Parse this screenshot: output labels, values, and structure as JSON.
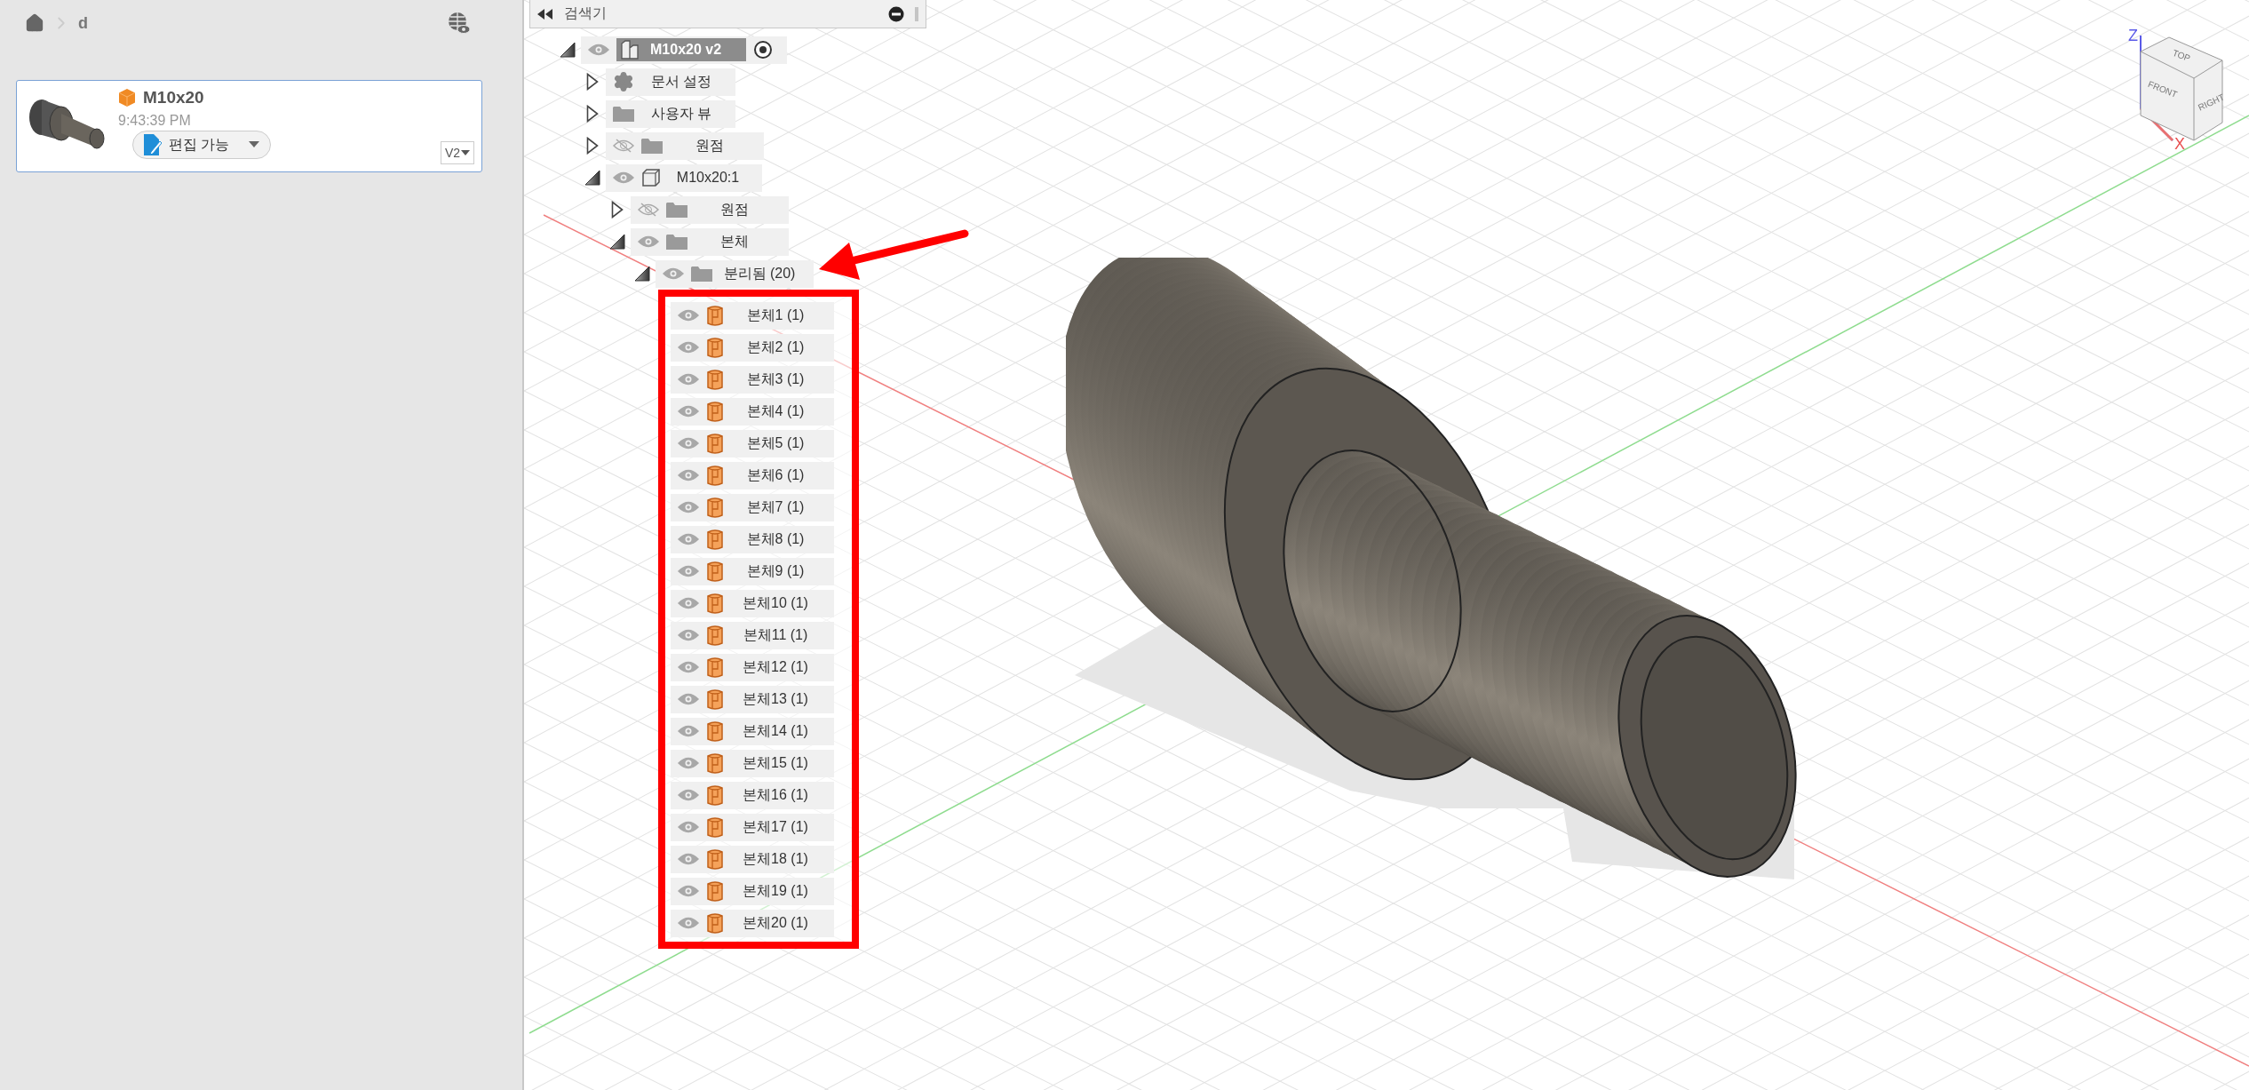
{
  "breadcrumb": [
    "d"
  ],
  "file_card": {
    "name": "M10x20",
    "time": "9:43:39 PM",
    "permission": "편집 가능",
    "version": "V2"
  },
  "browser": {
    "title": "검색기",
    "tree": [
      {
        "label": "M10x20 v2",
        "kind": "root",
        "visible": true,
        "expanded": true,
        "children": [
          {
            "label": "문서 설정",
            "kind": "settings",
            "expanded": false
          },
          {
            "label": "사용자 뷰",
            "kind": "folder",
            "expanded": false
          },
          {
            "label": "원점",
            "kind": "folder",
            "visible": false,
            "expanded": false
          },
          {
            "label": "M10x20:1",
            "kind": "component",
            "visible": true,
            "expanded": true,
            "children": [
              {
                "label": "원점",
                "kind": "folder",
                "visible": false,
                "expanded": false
              },
              {
                "label": "본체",
                "kind": "folder",
                "visible": true,
                "expanded": true,
                "children": [
                  {
                    "label": "분리됨 (20)",
                    "kind": "folder",
                    "visible": true,
                    "expanded": true,
                    "highlighted": true,
                    "children": [
                      {
                        "label": "본체1 (1)",
                        "kind": "body",
                        "visible": true
                      },
                      {
                        "label": "본체2 (1)",
                        "kind": "body",
                        "visible": true
                      },
                      {
                        "label": "본체3 (1)",
                        "kind": "body",
                        "visible": true
                      },
                      {
                        "label": "본체4 (1)",
                        "kind": "body",
                        "visible": true
                      },
                      {
                        "label": "본체5 (1)",
                        "kind": "body",
                        "visible": true
                      },
                      {
                        "label": "본체6 (1)",
                        "kind": "body",
                        "visible": true
                      },
                      {
                        "label": "본체7 (1)",
                        "kind": "body",
                        "visible": true
                      },
                      {
                        "label": "본체8 (1)",
                        "kind": "body",
                        "visible": true
                      },
                      {
                        "label": "본체9 (1)",
                        "kind": "body",
                        "visible": true
                      },
                      {
                        "label": "본체10 (1)",
                        "kind": "body",
                        "visible": true
                      },
                      {
                        "label": "본체11 (1)",
                        "kind": "body",
                        "visible": true
                      },
                      {
                        "label": "본체12 (1)",
                        "kind": "body",
                        "visible": true
                      },
                      {
                        "label": "본체13 (1)",
                        "kind": "body",
                        "visible": true
                      },
                      {
                        "label": "본체14 (1)",
                        "kind": "body",
                        "visible": true
                      },
                      {
                        "label": "본체15 (1)",
                        "kind": "body",
                        "visible": true
                      },
                      {
                        "label": "본체16 (1)",
                        "kind": "body",
                        "visible": true
                      },
                      {
                        "label": "본체17 (1)",
                        "kind": "body",
                        "visible": true
                      },
                      {
                        "label": "본체18 (1)",
                        "kind": "body",
                        "visible": true
                      },
                      {
                        "label": "본체19 (1)",
                        "kind": "body",
                        "visible": true
                      },
                      {
                        "label": "본체20 (1)",
                        "kind": "body",
                        "visible": true
                      }
                    ]
                  }
                ]
              }
            ]
          }
        ]
      }
    ]
  },
  "view_cube": {
    "faces": [
      "TOP",
      "FRONT",
      "RIGHT"
    ],
    "axes": [
      "Z",
      "X"
    ]
  }
}
